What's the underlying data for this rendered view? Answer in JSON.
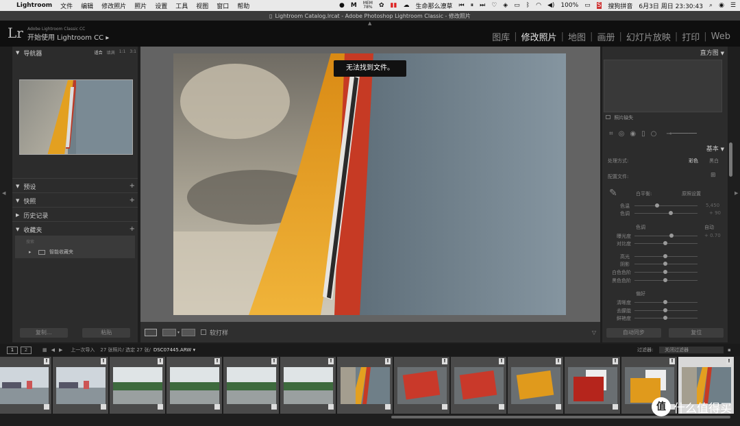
{
  "menubar": {
    "app": "Lightroom",
    "items": [
      "文件",
      "编辑",
      "修改照片",
      "照片",
      "设置",
      "工具",
      "视图",
      "窗口",
      "帮助"
    ],
    "mem_label": "MEM",
    "mem_value": "78%",
    "now_playing": "生命那么潦草",
    "battery": "100%",
    "input_method": "搜狗拼音",
    "datetime": "6月3日 周日  23:30:43"
  },
  "window": {
    "title": "Lightroom Catalog.lrcat - Adobe Photoshop Lightroom Classic - 修改照片"
  },
  "identity": {
    "logo": "Lr",
    "small": "Adobe Lightroom Classic CC",
    "big": "开始使用 Lightroom CC  ▸"
  },
  "modules": [
    {
      "label": "图库",
      "active": false
    },
    {
      "label": "修改照片",
      "active": true
    },
    {
      "label": "地图",
      "active": false
    },
    {
      "label": "画册",
      "active": false
    },
    {
      "label": "幻灯片放映",
      "active": false
    },
    {
      "label": "打印",
      "active": false
    },
    {
      "label": "Web",
      "active": false
    }
  ],
  "left_panel": {
    "navigator": "导航器",
    "nav_options": [
      "适合",
      "填满",
      "1:1",
      "3:1"
    ],
    "presets": "预设",
    "snapshots": "快照",
    "history": "历史记录",
    "collections": "收藏夹",
    "search_placeholder": "搜索",
    "smart_collection": "智能收藏夹",
    "copy_btn": "复制...",
    "paste_btn": "粘贴"
  },
  "center": {
    "toast": "无法找到文件。",
    "soft_proof": "软打样"
  },
  "right_panel": {
    "histogram": "直方图",
    "photo_missing": "照片缺失",
    "basic": "基本",
    "treatment_label": "处理方式:",
    "color": "彩色",
    "bw": "黑白",
    "profile_label": "配置文件:",
    "wb_label": "白平衡:",
    "wb_value": "原照设置",
    "temp": "色温",
    "temp_value": "5,450",
    "tint": "色调",
    "tint_value": "+ 90",
    "tone": "色调",
    "auto": "自动",
    "exposure": "曝光度",
    "exposure_value": "+ 0.70",
    "contrast": "对比度",
    "highlights": "高光",
    "shadows": "阴影",
    "whites": "白色色阶",
    "blacks": "黑色色阶",
    "presence": "偏好",
    "clarity": "清晰度",
    "dehaze": "去朦胧",
    "vibrance": "鲜艳度",
    "sync_btn": "自动同步",
    "reset_btn": "复位"
  },
  "filmstrip": {
    "page1": "1",
    "page2": "2",
    "source": "上一次导入",
    "count": "27 张照片/ 选定 27 张/",
    "file": "DSC07445.ARW ▾",
    "filter_label": "过滤器:",
    "filter_value": "关闭过滤器",
    "thumbs": [
      "scene-port",
      "scene-port",
      "scene-river",
      "scene-river",
      "scene-river",
      "scene-river",
      "scene-sleeve",
      "scene-red",
      "scene-red",
      "scene-orange",
      "scene-red-white",
      "scene-orange-white",
      "scene-sleeve"
    ]
  },
  "watermark": {
    "symbol": "值",
    "text": "什么值得买"
  }
}
